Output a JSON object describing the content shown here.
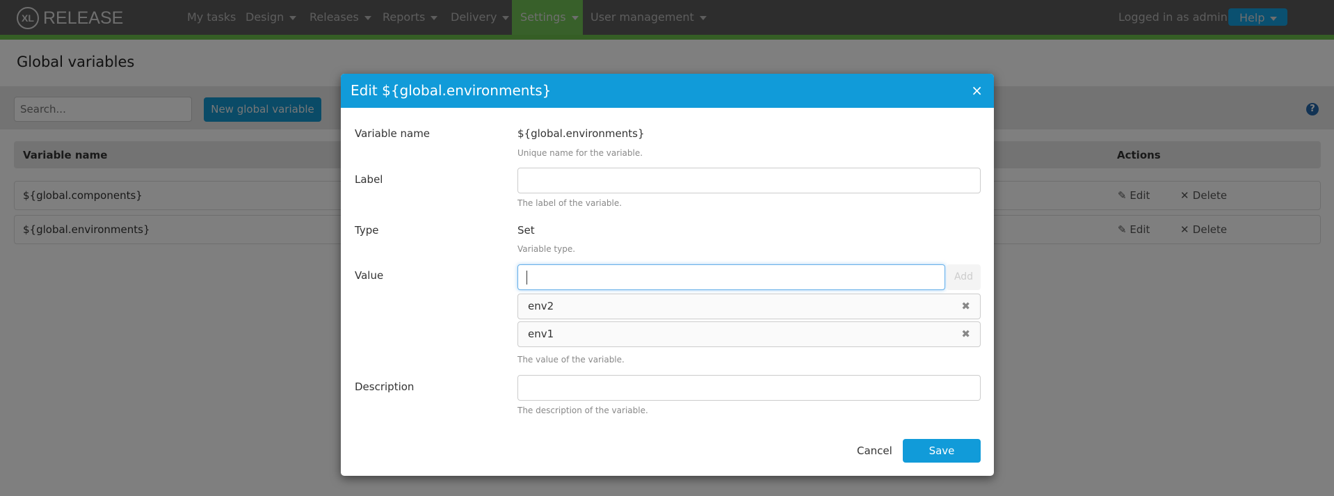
{
  "nav": {
    "logo_mark": "XL",
    "logo_text": "RELEASE",
    "items": [
      {
        "label": "My tasks",
        "dropdown": false
      },
      {
        "label": "Design",
        "dropdown": true
      },
      {
        "label": "Releases",
        "dropdown": true
      },
      {
        "label": "Reports",
        "dropdown": true
      },
      {
        "label": "Delivery",
        "dropdown": true
      },
      {
        "label": "Settings",
        "dropdown": true,
        "active": true
      },
      {
        "label": "User management",
        "dropdown": true
      }
    ],
    "user_text": "Logged in as admin",
    "help_label": "Help",
    "accent_color": "#6abc4a"
  },
  "page": {
    "title": "Global variables",
    "search_placeholder": "Search...",
    "new_button": "New global variable",
    "help_icon": "question-circle-icon",
    "table": {
      "columns": [
        "Variable name",
        "Actions"
      ],
      "rows": [
        {
          "name": "${global.components}",
          "edit": "Edit",
          "delete": "Delete"
        },
        {
          "name": "${global.environments}",
          "edit": "Edit",
          "delete": "Delete"
        }
      ]
    }
  },
  "modal": {
    "title": "Edit ${global.environments}",
    "close_icon": "×",
    "header_color": "#119bd9",
    "fields": {
      "name": {
        "label": "Variable name",
        "value": "${global.environments}",
        "hint": "Unique name for the variable."
      },
      "label": {
        "label": "Label",
        "value": "",
        "hint": "The label of the variable."
      },
      "type": {
        "label": "Type",
        "value": "Set",
        "hint": "Variable type."
      },
      "value": {
        "label": "Value",
        "input": "",
        "add": "Add",
        "items": [
          "env2",
          "env1"
        ],
        "hint": "The value of the variable."
      },
      "description": {
        "label": "Description",
        "value": "",
        "hint": "The description of the variable."
      }
    },
    "cancel": "Cancel",
    "save": "Save"
  }
}
